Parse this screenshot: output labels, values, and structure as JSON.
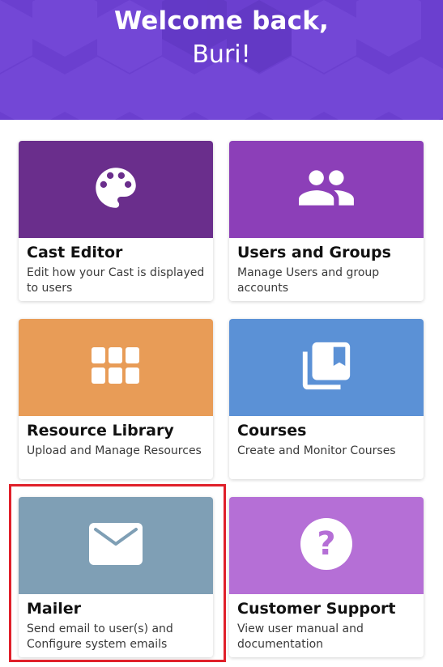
{
  "header": {
    "greeting": "Welcome back,",
    "user_name": "Buri!",
    "background_color": "#6b3fcf"
  },
  "cards": {
    "cast_editor": {
      "title": "Cast Editor",
      "description": "Edit how your Cast is displayed to users",
      "icon": "palette-icon",
      "color": "#6a2e8c"
    },
    "users_groups": {
      "title": "Users and Groups",
      "description": "Manage Users and group accounts",
      "icon": "people-icon",
      "color": "#8c3fb8"
    },
    "resource_library": {
      "title": "Resource Library",
      "description": "Upload and Manage Resources",
      "icon": "grid-apps-icon",
      "color": "#e89c57"
    },
    "courses": {
      "title": "Courses",
      "description": "Create and Monitor Courses",
      "icon": "library-books-icon",
      "color": "#5b91d6"
    },
    "mailer": {
      "title": "Mailer",
      "description": "Send email to user(s) and Configure system emails",
      "icon": "envelope-icon",
      "color": "#7f9fb5"
    },
    "customer_support": {
      "title": "Customer Support",
      "description": "View user manual and documentation",
      "icon": "help-circle-icon",
      "color": "#b56fd6"
    }
  },
  "highlight": {
    "target": "mailer",
    "color": "#e0202a"
  }
}
